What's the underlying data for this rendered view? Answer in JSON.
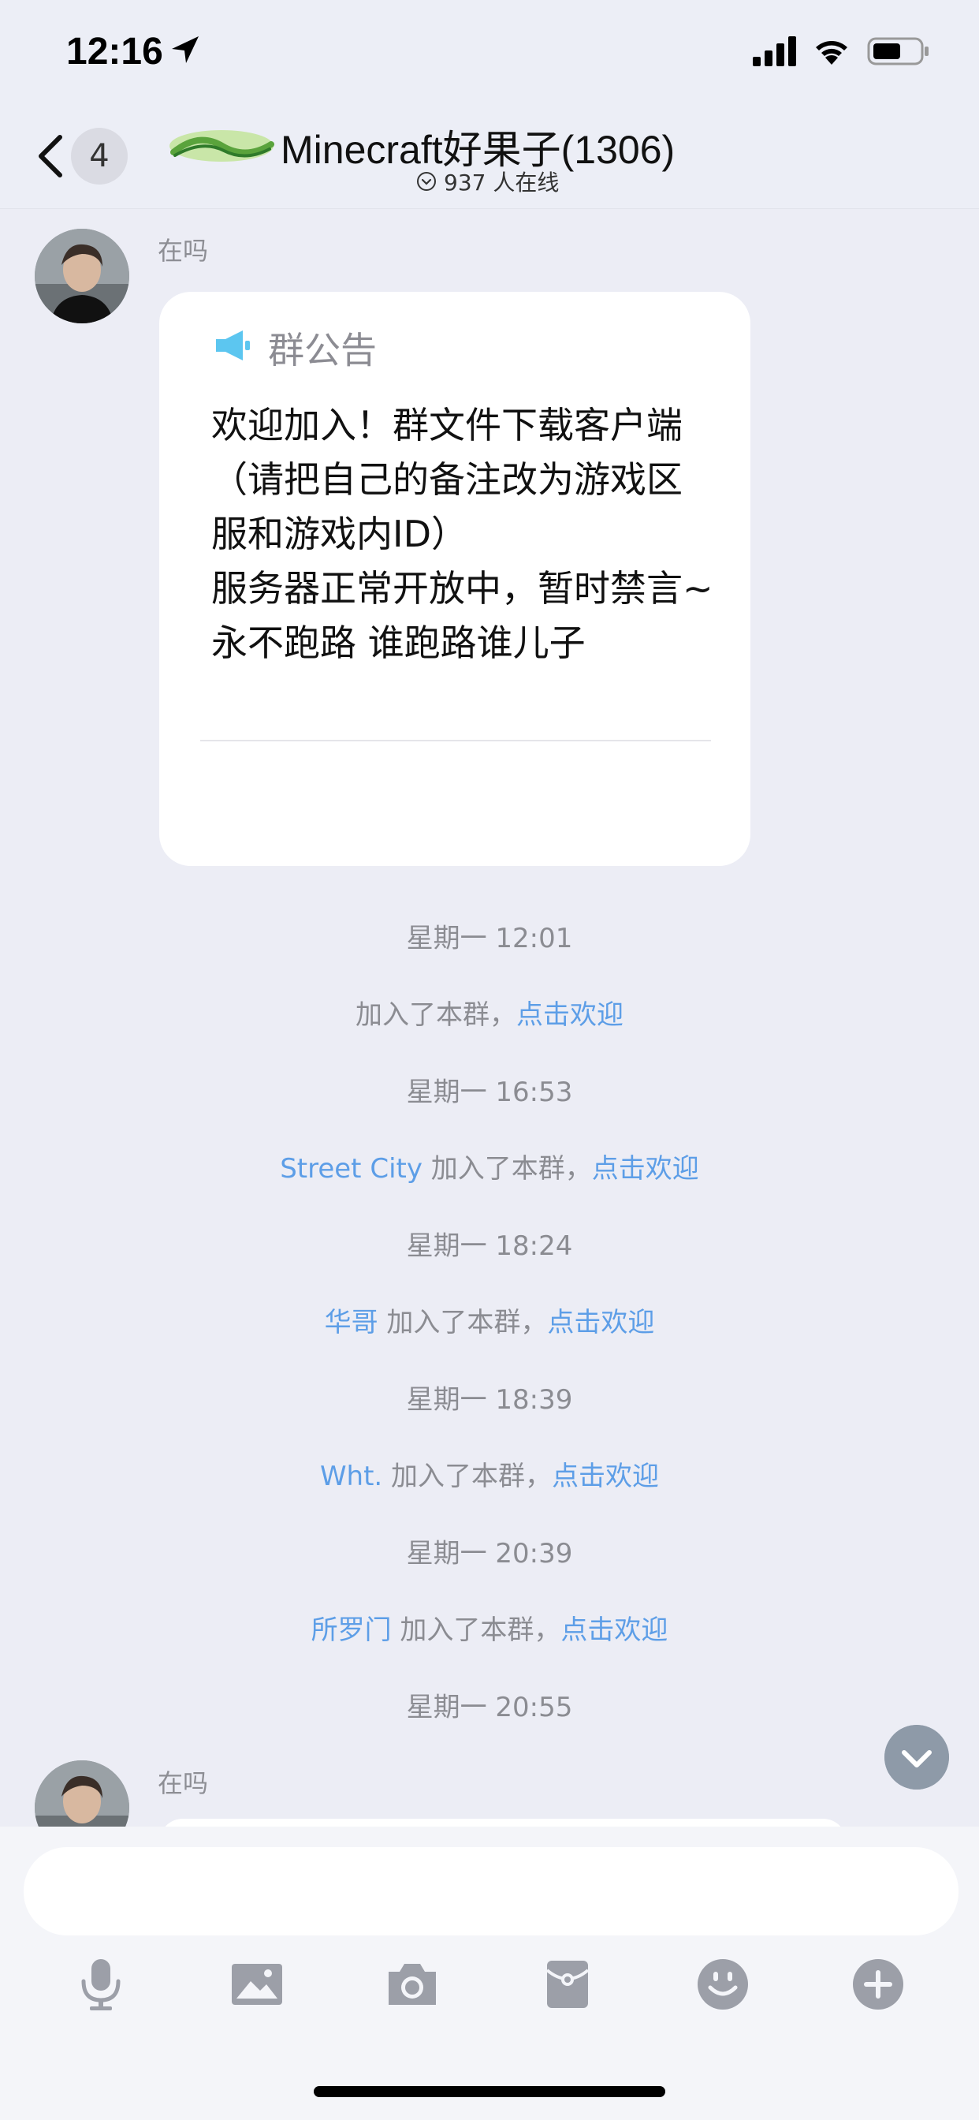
{
  "status_bar": {
    "time": "12:16"
  },
  "header": {
    "back_count": "4",
    "title": "Minecraft好果子(1306)",
    "online": "937 人在线"
  },
  "messages": {
    "sender1": "在吗",
    "announcement": {
      "title": "群公告",
      "body": "欢迎加入！群文件下载客户端（请把自己的备注改为游戏区服和游戏内ID）\n服务器正常开放中，暂时禁言~\n永不跑路 谁跑路谁儿子"
    },
    "system": [
      {
        "time": "星期一 12:01",
        "name": "",
        "text": "加入了本群，",
        "link": "点击欢迎"
      },
      {
        "time": "星期一 16:53",
        "name": "Street City",
        "text": " 加入了本群，",
        "link": "点击欢迎"
      },
      {
        "time": "星期一 18:24",
        "name": "华哥",
        "text": " 加入了本群，",
        "link": "点击欢迎"
      },
      {
        "time": "星期一 18:39",
        "name": "Wht.",
        "text": " 加入了本群，",
        "link": "点击欢迎"
      },
      {
        "time": "星期一 20:39",
        "name": "所罗门",
        "text": " 加入了本群，",
        "link": "点击欢迎"
      }
    ],
    "last_time": "星期一 20:55",
    "sender2": "在吗"
  },
  "input": {
    "value": "",
    "placeholder": ""
  },
  "toolbar": [
    "mic-icon",
    "image-icon",
    "camera-icon",
    "red-packet-icon",
    "emoji-icon",
    "plus-icon"
  ],
  "colors": {
    "link": "#5d9ee7",
    "background": "#ecedf5",
    "icon": "#9c9fa8"
  }
}
